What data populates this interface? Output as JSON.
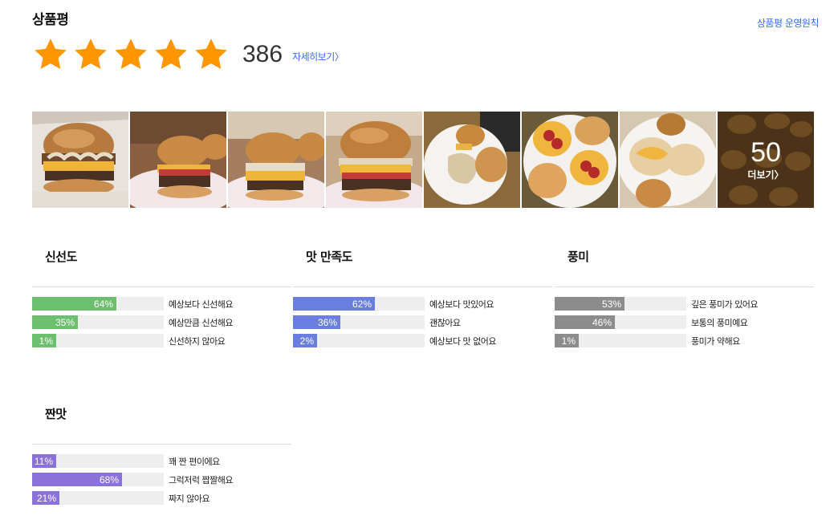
{
  "header": {
    "title": "상품평",
    "policy_link": "상품평 운영원칙"
  },
  "rating": {
    "stars": 5,
    "count": "386",
    "detail_link": "자세히보기"
  },
  "gallery": {
    "more_count": "50",
    "more_label": "더보기"
  },
  "surveys": [
    {
      "title": "신선도",
      "color": "#6cbf6c",
      "options": [
        {
          "label": "예상보다 신선해요",
          "percent": 64,
          "percent_text": "64%"
        },
        {
          "label": "예상만큼 신선해요",
          "percent": 35,
          "percent_text": "35%"
        },
        {
          "label": "신선하지 않아요",
          "percent": 1,
          "percent_text": "1%"
        }
      ]
    },
    {
      "title": "맛 만족도",
      "color": "#6a7ee0",
      "options": [
        {
          "label": "예상보다 맛있어요",
          "percent": 62,
          "percent_text": "62%"
        },
        {
          "label": "괜찮아요",
          "percent": 36,
          "percent_text": "36%"
        },
        {
          "label": "예상보다 맛 없어요",
          "percent": 2,
          "percent_text": "2%"
        }
      ]
    },
    {
      "title": "풍미",
      "color": "#8c8c8c",
      "options": [
        {
          "label": "깊은 풍미가 있어요",
          "percent": 53,
          "percent_text": "53%"
        },
        {
          "label": "보통의 풍미예요",
          "percent": 46,
          "percent_text": "46%"
        },
        {
          "label": "풍미가 약해요",
          "percent": 1,
          "percent_text": "1%"
        }
      ]
    },
    {
      "title": "짠맛",
      "color": "#8a72d8",
      "options": [
        {
          "label": "꽤 짠 편이에요",
          "percent": 11,
          "percent_text": "11%"
        },
        {
          "label": "그럭저럭 짭짤해요",
          "percent": 68,
          "percent_text": "68%"
        },
        {
          "label": "짜지 않아요",
          "percent": 21,
          "percent_text": "21%"
        }
      ]
    }
  ]
}
